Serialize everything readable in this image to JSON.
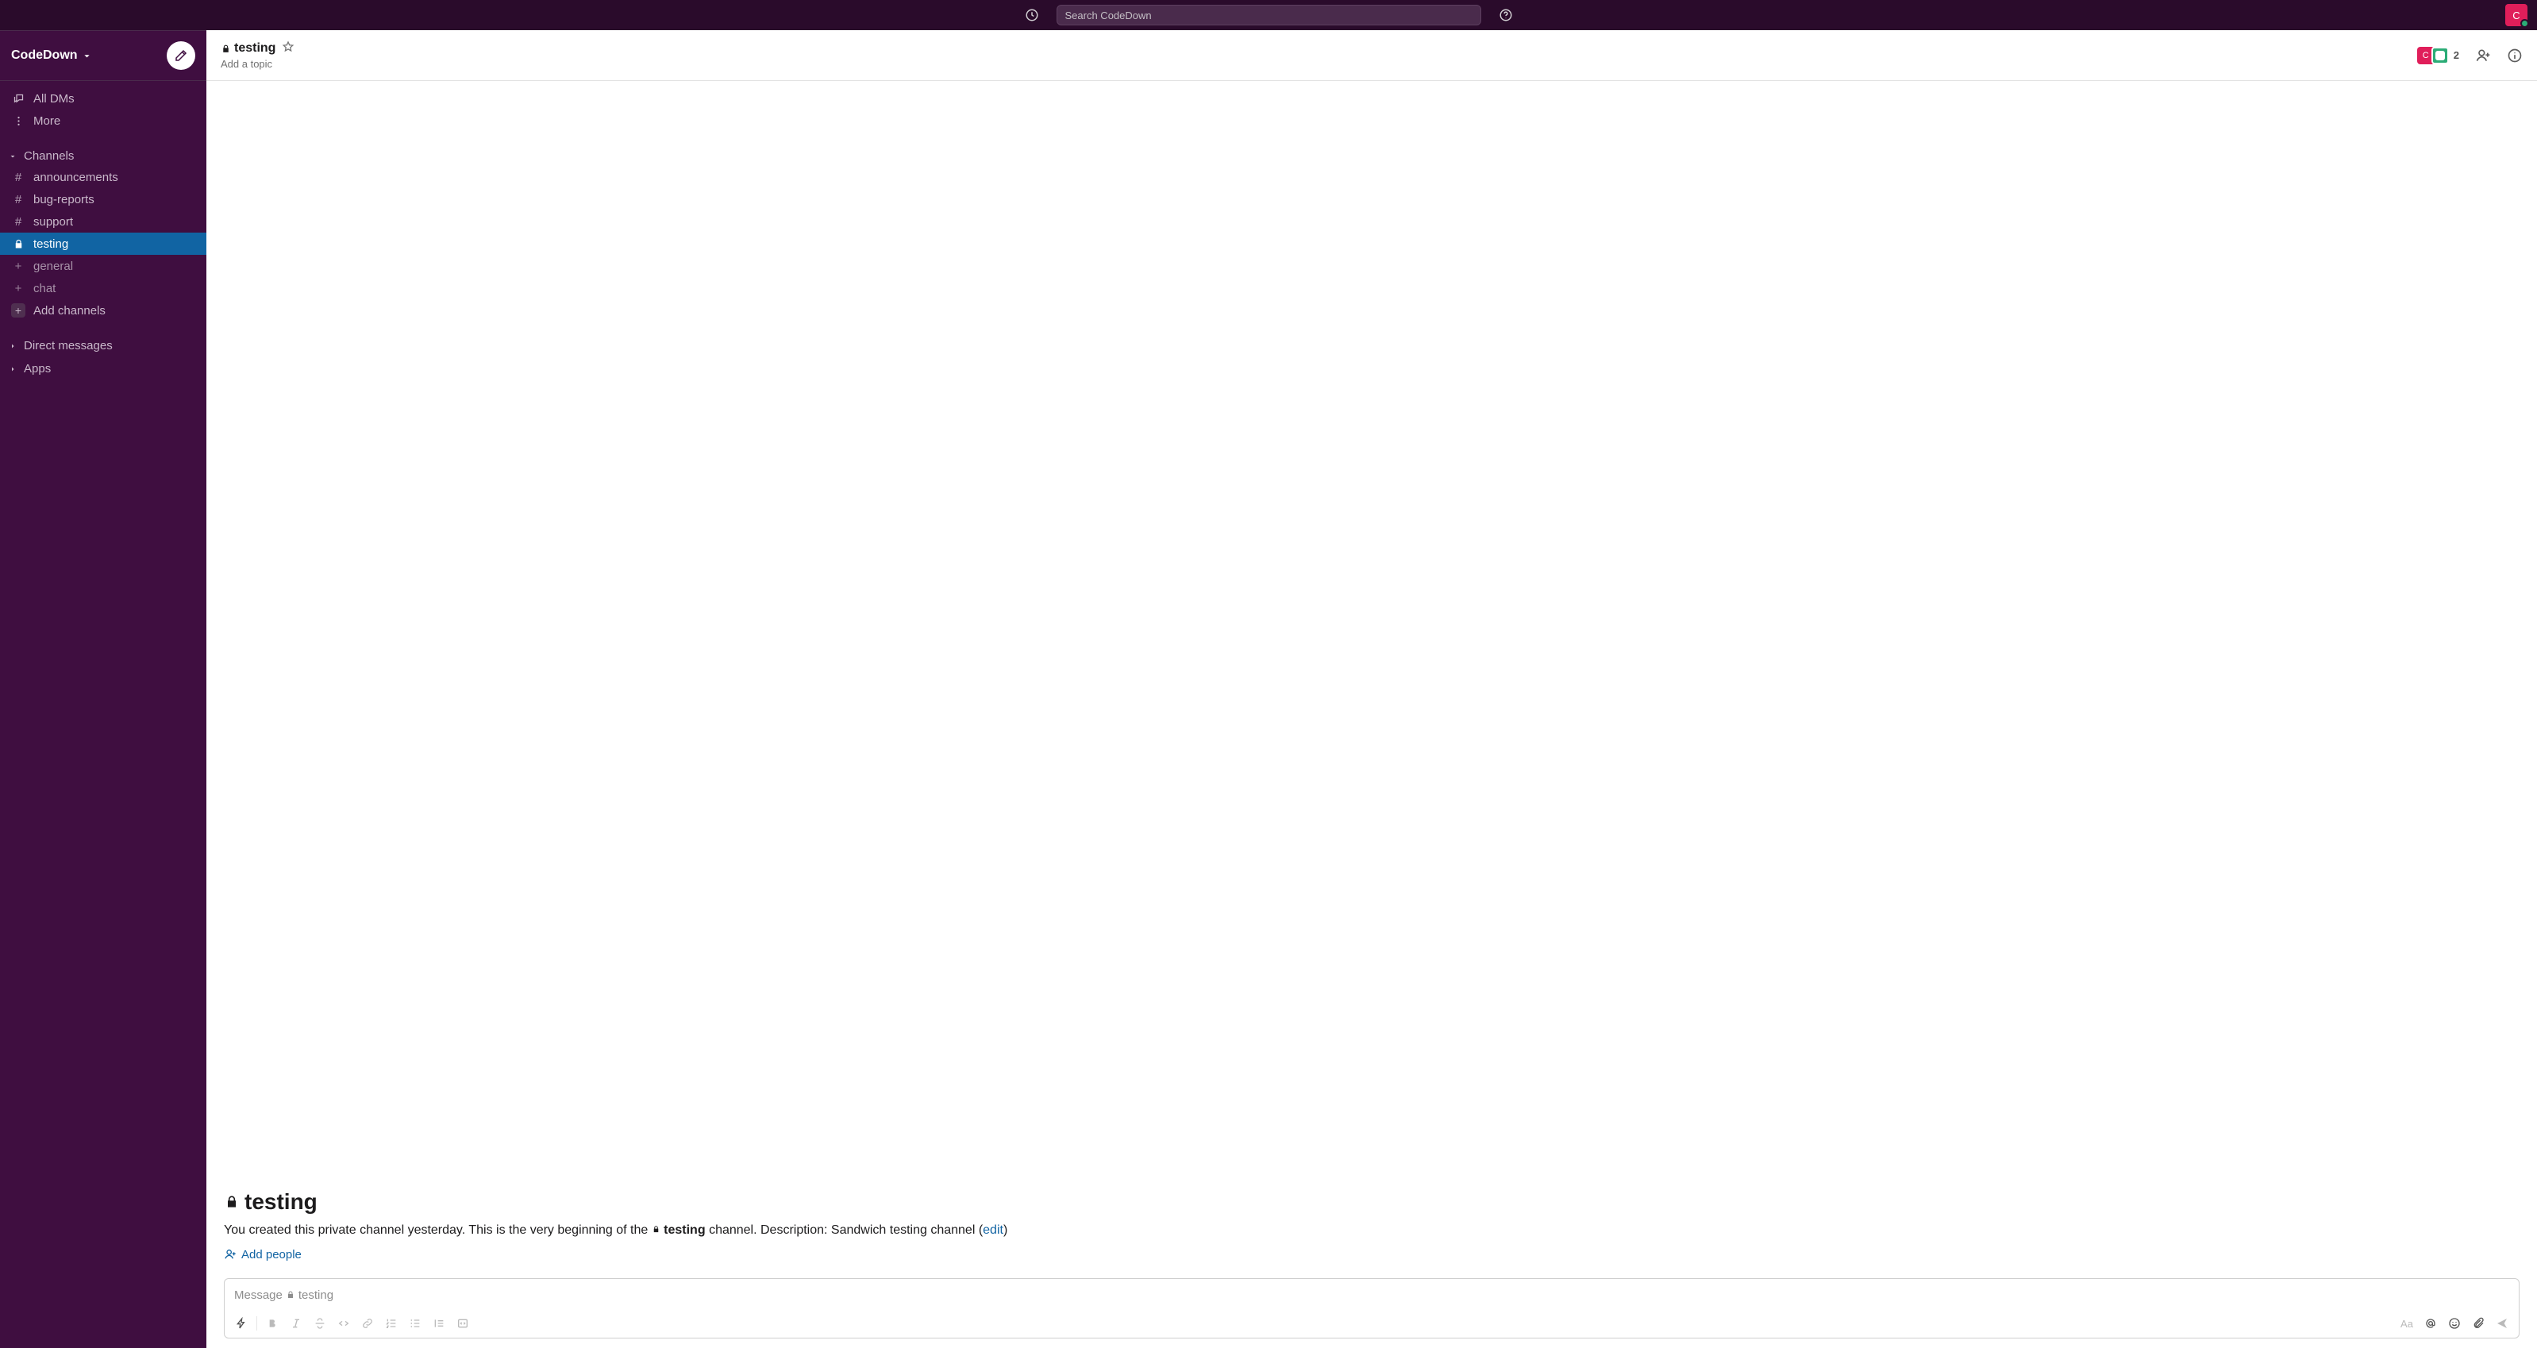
{
  "topbar": {
    "search_placeholder": "Search CodeDown",
    "avatar_letter": "C"
  },
  "sidebar": {
    "workspace_name": "CodeDown",
    "nav": {
      "all_dms": "All DMs",
      "more": "More"
    },
    "channels_header": "Channels",
    "channels": [
      {
        "name": "announcements",
        "type": "public"
      },
      {
        "name": "bug-reports",
        "type": "public"
      },
      {
        "name": "support",
        "type": "public"
      },
      {
        "name": "testing",
        "type": "private",
        "active": true
      },
      {
        "name": "general",
        "type": "draft"
      },
      {
        "name": "chat",
        "type": "draft"
      }
    ],
    "add_channels": "Add channels",
    "dm_header": "Direct messages",
    "apps_header": "Apps"
  },
  "channel": {
    "name": "testing",
    "topic_placeholder": "Add a topic",
    "member_count": "2",
    "avatar_letter": "C",
    "intro": {
      "pre": "You created this private channel yesterday. This is the very beginning of the ",
      "mid": " channel. Description: Sandwich testing channel (",
      "edit": "edit",
      "post": ")"
    },
    "add_people": "Add people",
    "composer": {
      "placeholder_prefix": "Message ",
      "aa": "Aa"
    }
  }
}
